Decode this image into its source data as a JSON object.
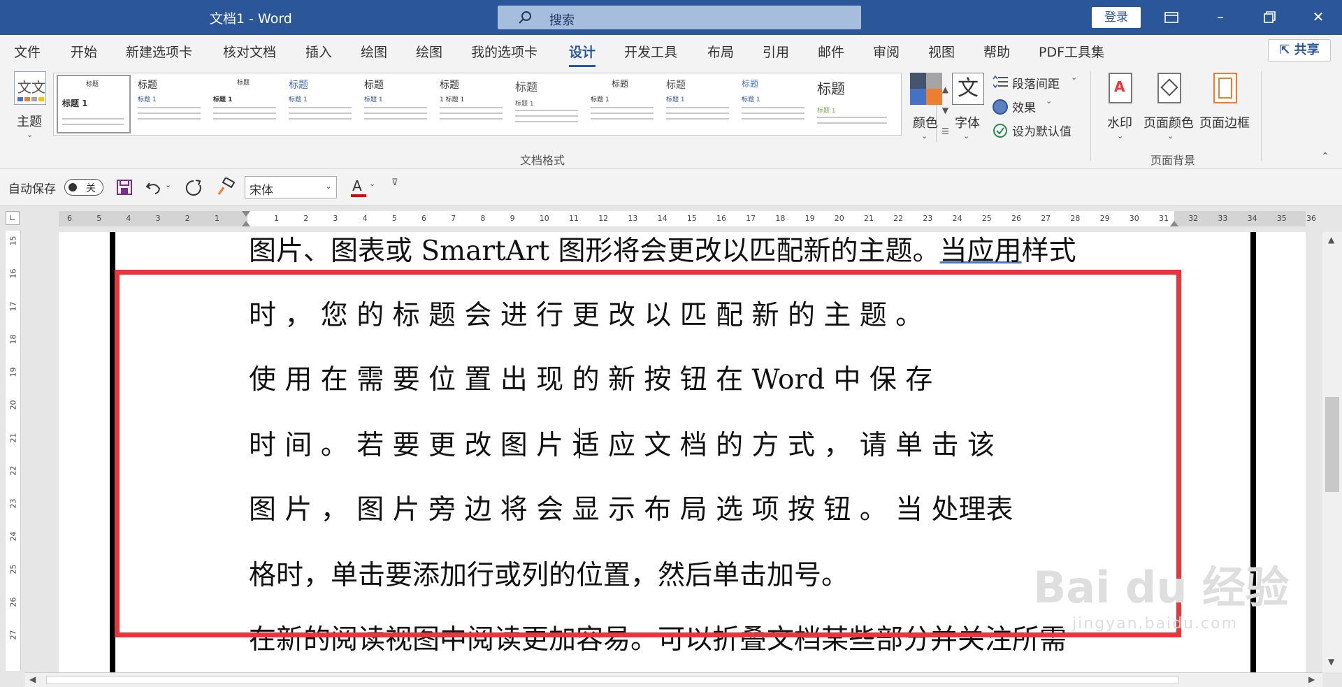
{
  "titlebar": {
    "title": "文档1  -  Word",
    "search_placeholder": "搜索",
    "login_label": "登录"
  },
  "menu": {
    "tabs": [
      "文件",
      "开始",
      "新建选项卡",
      "核对文档",
      "插入",
      "绘图",
      "绘图",
      "我的选项卡",
      "设计",
      "开发工具",
      "布局",
      "引用",
      "邮件",
      "审阅",
      "视图",
      "帮助",
      "PDF工具集"
    ],
    "active_tab": "设计",
    "share_label": "共享"
  },
  "ribbon": {
    "theme_label": "主题",
    "theme_icon_text": "文文",
    "gallery": {
      "items": [
        {
          "heading": "标题",
          "sub": "标题 1"
        },
        {
          "heading": "标题",
          "sub": "标题 1"
        },
        {
          "heading": "标题",
          "sub": "标题 1"
        },
        {
          "heading": "标题",
          "sub": "标题 1"
        },
        {
          "heading": "标题",
          "sub": "标题 1"
        },
        {
          "heading": "标题",
          "sub": "1  标题 1"
        },
        {
          "heading": "标题",
          "sub": "标题 1"
        },
        {
          "heading": "标题",
          "sub": "标题 1"
        },
        {
          "heading": "标题",
          "sub": "标题 1"
        },
        {
          "heading": "标题",
          "sub": "标题 1"
        },
        {
          "heading": "标题",
          "sub": "标题 1"
        }
      ]
    },
    "colors_label": "颜色",
    "fonts_label": "字体",
    "fonts_icon_text": "文",
    "paragraph_spacing_label": "段落间距",
    "effects_label": "效果",
    "set_default_label": "设为默认值",
    "document_format_group": "文档格式",
    "watermark_label": "水印",
    "page_color_label": "页面颜色",
    "page_borders_label": "页面边框",
    "page_background_group": "页面背景"
  },
  "qat": {
    "autosave_label": "自动保存",
    "autosave_state": "关",
    "font_name": "宋体",
    "font_color_letter": "A"
  },
  "ruler": {
    "horizontal_left": [
      "6",
      "5",
      "4",
      "3",
      "2",
      "1"
    ],
    "horizontal_right": [
      "1",
      "2",
      "3",
      "4",
      "5",
      "6",
      "7",
      "8",
      "9",
      "10",
      "11",
      "12",
      "13",
      "14",
      "15",
      "16",
      "17",
      "18",
      "19",
      "20",
      "21",
      "22",
      "23",
      "24",
      "25",
      "26",
      "27",
      "28",
      "29",
      "30",
      "31",
      "32",
      "33",
      "34",
      "35",
      "36"
    ],
    "vertical": [
      "15",
      "16",
      "17",
      "18",
      "19",
      "20",
      "21",
      "22",
      "23",
      "24",
      "25",
      "26",
      "27"
    ]
  },
  "document": {
    "line1_a": "图片、图表或 SmartArt 图形将会更改以匹配新的主题。",
    "line1_b": "当应用",
    "line1_c": "样式",
    "line2": "时 ， 您 的 标 题 会 进 行 更 改 以 匹 配 新 的 主 题 。",
    "line3": "使 用 在 需 要 位 置 出 现 的 新 按 钮 在  Word  中 保 存",
    "line4": "时 间 。 若 要 更 改 图 片 适 应 文 档 的 方 式 ， 请 单 击 该",
    "line5": "图 片 ， 图 片 旁 边 将 会 显 示 布 局 选 项 按 钮 。 当 处理表",
    "line6": "格时，单击要添加行或列的位置，然后单击加号。",
    "line7": "在新的阅读视图中阅读更加容易。可以折叠文档某些部分并关注所需"
  },
  "watermark": {
    "text1": "Bai du 经验",
    "text2": "jingyan.baidu.com"
  },
  "colors": {
    "titlebar": "#2b579a",
    "highlight_box": "#e8363a"
  }
}
